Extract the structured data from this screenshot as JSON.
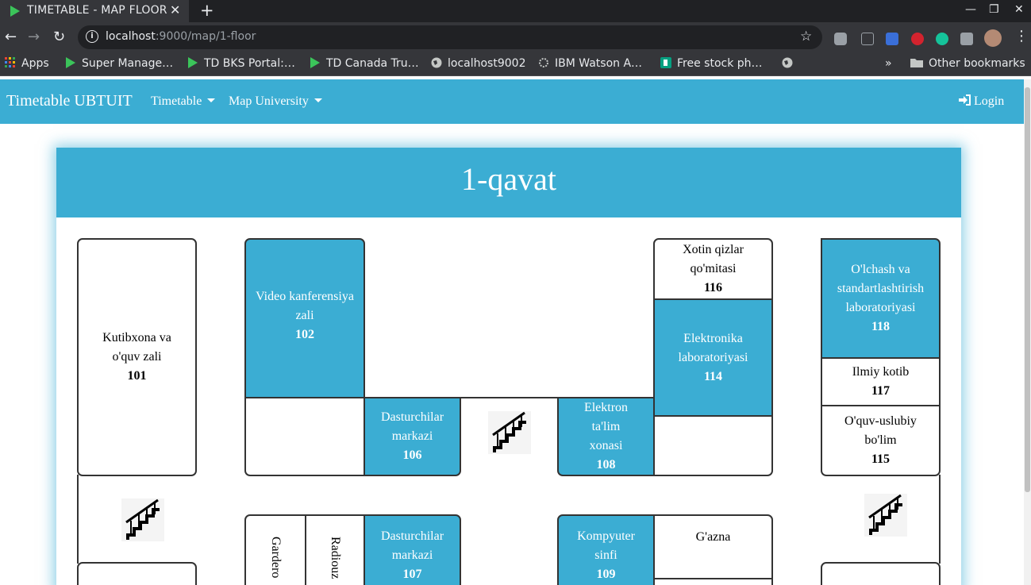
{
  "browser": {
    "tab_title": "TIMETABLE - MAP FLOOR",
    "url_host": "localhost",
    "url_rest": ":9000/map/1-floor",
    "bookmarks": [
      {
        "label": "Apps",
        "icon": "apps-grid-icon"
      },
      {
        "label": "Super Manage…",
        "icon": "play-icon"
      },
      {
        "label": "TD BKS Portal:…",
        "icon": "play-icon"
      },
      {
        "label": "TD Canada Tru…",
        "icon": "play-icon"
      },
      {
        "label": "localhost9002",
        "icon": "globe-icon"
      },
      {
        "label": "IBM Watson A…",
        "icon": "watson-icon"
      },
      {
        "label": "Free stock ph…",
        "icon": "stock-icon"
      }
    ],
    "other_bookmarks": "Other bookmarks"
  },
  "navbar": {
    "brand": "Timetable UBTUIT",
    "menu_timetable": "Timetable",
    "menu_map": "Map University",
    "login": "Login"
  },
  "floor": {
    "title": "1-qavat",
    "rooms": [
      {
        "name": "Kutibxona va o'quv zali",
        "number": "101"
      },
      {
        "name": "Video kanferensiya zali",
        "number": "102"
      },
      {
        "name": "Dasturchilar markazi",
        "number": "106"
      },
      {
        "name": "Elektron ta'lim xonasi",
        "number": "108"
      },
      {
        "name": "Xotin qizlar qo'mitasi",
        "number": "116"
      },
      {
        "name": "Elektronika laboratoriyasi",
        "number": "114"
      },
      {
        "name": "O'lchash va standartlashtirish laboratoriyasi",
        "number": "118"
      },
      {
        "name": "Ilmiy kotib",
        "number": "117"
      },
      {
        "name": "O'quv-uslubiy bo'lim",
        "number": "115"
      },
      {
        "name": "Dasturchilar markazi",
        "number": "107"
      },
      {
        "name": "Kompyuter sinfi",
        "number": "109"
      },
      {
        "name": "G'azna",
        "number": ""
      },
      {
        "name": "Gardero",
        "number": ""
      },
      {
        "name": "Radiouz",
        "number": ""
      }
    ]
  },
  "colors": {
    "accent": "#3badd3",
    "chrome_dark": "#202124",
    "chrome": "#35363a"
  }
}
